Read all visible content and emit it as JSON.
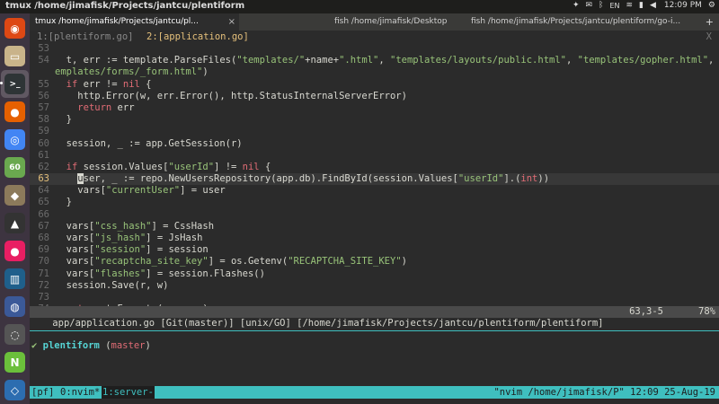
{
  "topbar": {
    "title": "tmux /home/jimafisk/Projects/jantcu/plentiform",
    "lang": "EN",
    "clock": "12:09 PM"
  },
  "launcher": {
    "items": [
      {
        "name": "ubuntu-icon",
        "glyph": "◉",
        "color": "#dd4814"
      },
      {
        "name": "files-icon",
        "glyph": "▭",
        "color": "#c9b38a"
      },
      {
        "name": "terminal-icon",
        "glyph": ">_",
        "color": "#2e3436",
        "active": true
      },
      {
        "name": "firefox-icon",
        "glyph": "●",
        "color": "#e66000"
      },
      {
        "name": "chrome-icon",
        "glyph": "◎",
        "color": "#4285f4"
      },
      {
        "name": "pycharm-icon",
        "glyph": "60",
        "color": "#6aa84f"
      },
      {
        "name": "gimp-icon",
        "glyph": "◆",
        "color": "#8c7a5b"
      },
      {
        "name": "inkscape-icon",
        "glyph": "▲",
        "color": "#333333"
      },
      {
        "name": "color-app-icon",
        "glyph": "●",
        "color": "#e91e63"
      },
      {
        "name": "books-icon",
        "glyph": "▥",
        "color": "#1f5f8b"
      },
      {
        "name": "virtualbox-icon",
        "glyph": "◍",
        "color": "#3b5998"
      },
      {
        "name": "settings-icon",
        "glyph": "◌",
        "color": "#555555"
      },
      {
        "name": "nvidia-icon",
        "glyph": "N",
        "color": "#6bbf3b"
      },
      {
        "name": "network-icon",
        "glyph": "◇",
        "color": "#2c6db0"
      }
    ]
  },
  "tabs": [
    {
      "label": "tmux /home/jimafisk/Projects/jantcu/pl...",
      "active": true
    },
    {
      "label": "fish /home/jimafisk/Desktop",
      "active": false
    },
    {
      "label": "fish /home/jimafisk/Projects/jantcu/plentiform/go-i...",
      "active": false
    }
  ],
  "tab_add": "+",
  "tab_close": "×",
  "buffers": {
    "tab1": "1:[plentiform.go]",
    "tab2": "2:[application.go]",
    "close": "X"
  },
  "code": [
    {
      "n": "53",
      "parts": []
    },
    {
      "n": "54",
      "parts": [
        {
          "t": "  t, err := template.ParseFiles("
        },
        {
          "t": "\"templates/\"",
          "c": "str"
        },
        {
          "t": "+name+"
        },
        {
          "t": "\".html\"",
          "c": "str"
        },
        {
          "t": ", "
        },
        {
          "t": "\"templates/layouts/public.html\"",
          "c": "str"
        },
        {
          "t": ", "
        },
        {
          "t": "\"templates/gopher.html\"",
          "c": "str"
        },
        {
          "t": ", \"t"
        }
      ]
    },
    {
      "n": "",
      "parts": [
        {
          "t": "emplates/forms/_form.html\"",
          "c": "str"
        },
        {
          "t": ")"
        }
      ]
    },
    {
      "n": "55",
      "parts": [
        {
          "t": "  "
        },
        {
          "t": "if",
          "c": "kw"
        },
        {
          "t": " err != "
        },
        {
          "t": "nil",
          "c": "kw"
        },
        {
          "t": " {"
        }
      ]
    },
    {
      "n": "56",
      "parts": [
        {
          "t": "    http.Error(w, err.Error(), http.StatusInternalServerError)"
        }
      ]
    },
    {
      "n": "57",
      "parts": [
        {
          "t": "    "
        },
        {
          "t": "return",
          "c": "kw"
        },
        {
          "t": " err"
        }
      ]
    },
    {
      "n": "58",
      "parts": [
        {
          "t": "  }"
        }
      ]
    },
    {
      "n": "59",
      "parts": []
    },
    {
      "n": "60",
      "parts": [
        {
          "t": "  session, _ := app.GetSession(r)"
        }
      ]
    },
    {
      "n": "61",
      "parts": []
    },
    {
      "n": "62",
      "parts": [
        {
          "t": "  "
        },
        {
          "t": "if",
          "c": "kw"
        },
        {
          "t": " session.Values["
        },
        {
          "t": "\"userId\"",
          "c": "str"
        },
        {
          "t": "] != "
        },
        {
          "t": "nil",
          "c": "kw"
        },
        {
          "t": " {"
        }
      ]
    },
    {
      "n": "63",
      "cur": true,
      "parts": [
        {
          "t": "    "
        },
        {
          "t": "u",
          "c": "cursor"
        },
        {
          "t": "ser, _ := repo.NewUsersRepository(app.db).FindById(session.Values["
        },
        {
          "t": "\"userId\"",
          "c": "str"
        },
        {
          "t": "].("
        },
        {
          "t": "int",
          "c": "kw"
        },
        {
          "t": "))"
        }
      ]
    },
    {
      "n": "64",
      "parts": [
        {
          "t": "    vars["
        },
        {
          "t": "\"currentUser\"",
          "c": "str"
        },
        {
          "t": "] = user"
        }
      ]
    },
    {
      "n": "65",
      "parts": [
        {
          "t": "  }"
        }
      ]
    },
    {
      "n": "66",
      "parts": []
    },
    {
      "n": "67",
      "parts": [
        {
          "t": "  vars["
        },
        {
          "t": "\"css_hash\"",
          "c": "str"
        },
        {
          "t": "] = CssHash"
        }
      ]
    },
    {
      "n": "68",
      "parts": [
        {
          "t": "  vars["
        },
        {
          "t": "\"js_hash\"",
          "c": "str"
        },
        {
          "t": "] = JsHash"
        }
      ]
    },
    {
      "n": "69",
      "parts": [
        {
          "t": "  vars["
        },
        {
          "t": "\"session\"",
          "c": "str"
        },
        {
          "t": "] = session"
        }
      ]
    },
    {
      "n": "70",
      "parts": [
        {
          "t": "  vars["
        },
        {
          "t": "\"recaptcha_site_key\"",
          "c": "str"
        },
        {
          "t": "] = os.Getenv("
        },
        {
          "t": "\"RECAPTCHA_SITE_KEY\"",
          "c": "str"
        },
        {
          "t": ")"
        }
      ]
    },
    {
      "n": "71",
      "parts": [
        {
          "t": "  vars["
        },
        {
          "t": "\"flashes\"",
          "c": "str"
        },
        {
          "t": "] = session.Flashes()"
        }
      ]
    },
    {
      "n": "72",
      "parts": [
        {
          "t": "  session.Save(r, w)"
        }
      ]
    },
    {
      "n": "73",
      "parts": []
    },
    {
      "n": "74",
      "parts": [
        {
          "t": "  "
        },
        {
          "t": "return",
          "c": "kw"
        },
        {
          "t": " t.Execute(w, vars)"
        }
      ]
    }
  ],
  "statusline": {
    "left": "app/application.go [Git(master)] [unix/GO] [/home/jimafisk/Projects/jantcu/plentiform/plentiform]",
    "pos": "63,3-5",
    "pct": "78%"
  },
  "prompt": {
    "check": "✔",
    "dir": "plentiform",
    "branch_open": " (",
    "branch": "master",
    "branch_close": ")"
  },
  "tmux": {
    "session": "[pf]",
    "win0": "0:nvim*",
    "win1": "1:server-",
    "right": "\"nvim /home/jimafisk/P\" 12:09 25-Aug-19"
  }
}
